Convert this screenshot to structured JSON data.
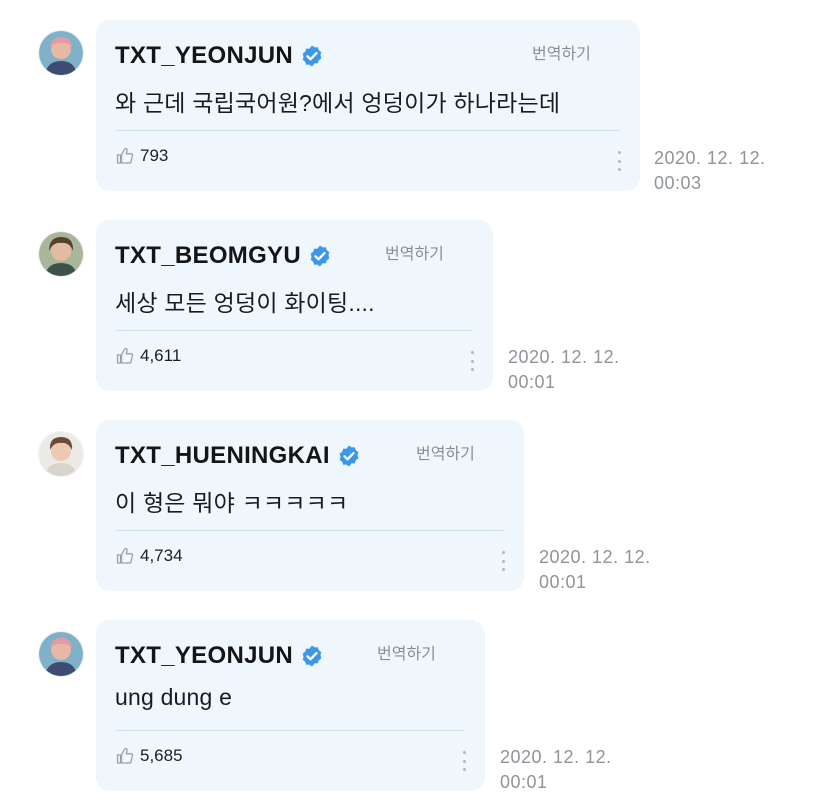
{
  "comments": [
    {
      "username": "TXT_YEONJUN",
      "avatar": "avatar-yeonjun",
      "translate_label": "번역하기",
      "text": "와 근데 국립국어원?에서 엉덩이가 하나라는데",
      "likes": "793",
      "date": "2020. 12. 12.",
      "time": "00:03"
    },
    {
      "username": "TXT_BEOMGYU",
      "avatar": "avatar-beomgyu",
      "translate_label": "번역하기",
      "text": "세상 모든 엉덩이 화이팅....",
      "likes": "4,611",
      "date": "2020. 12. 12.",
      "time": "00:01"
    },
    {
      "username": "TXT_HUENINGKAI",
      "avatar": "avatar-hueningkai",
      "translate_label": "번역하기",
      "text": "이 형은 뭐야 ㅋㅋㅋㅋㅋ",
      "likes": "4,734",
      "date": "2020. 12. 12.",
      "time": "00:01"
    },
    {
      "username": "TXT_YEONJUN",
      "avatar": "avatar-yeonjun",
      "translate_label": "번역하기",
      "text": "ung dung e",
      "likes": "5,685",
      "date": "2020. 12. 12.",
      "time": "00:01"
    }
  ],
  "colors": {
    "bubble": "#eff7fd",
    "verified": "#3b97e8",
    "muted": "#8a8f94"
  },
  "icons": {
    "verified": "verified-badge-icon",
    "like": "thumbs-up-icon",
    "more": "more-vertical-icon"
  }
}
